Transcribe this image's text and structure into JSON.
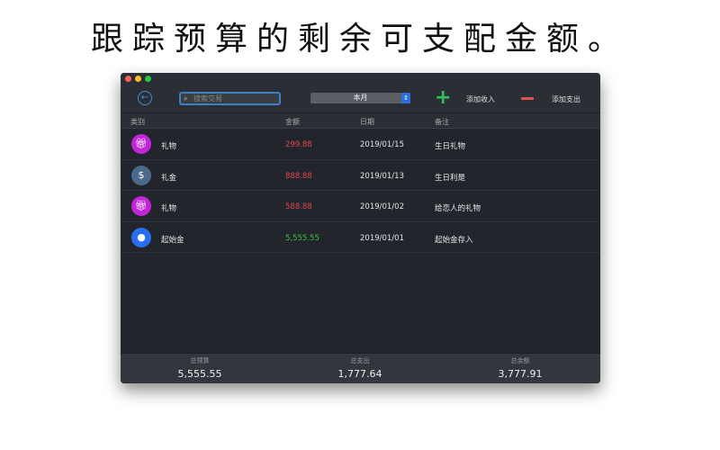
{
  "headline": "跟踪预算的剩余可支配金额。",
  "toolbar": {
    "search_placeholder": "搜索交易",
    "period": "本月",
    "add_income": "添加收入",
    "add_expense": "添加支出"
  },
  "columns": {
    "category": "类别",
    "amount": "金额",
    "date": "日期",
    "note": "备注"
  },
  "rows": [
    {
      "category": "礼物",
      "amount": "299.88",
      "date": "2019/01/15",
      "note": "生日礼物",
      "icon": "gift-icon",
      "icon_color": "#c126d6",
      "amount_color": "#e0474c"
    },
    {
      "category": "礼金",
      "amount": "888.88",
      "date": "2019/01/13",
      "note": "生日利是",
      "icon": "money-bag-icon",
      "icon_color": "#4a6a8c",
      "amount_color": "#e0474c"
    },
    {
      "category": "礼物",
      "amount": "588.88",
      "date": "2019/01/02",
      "note": "给恋人的礼物",
      "icon": "gift-icon",
      "icon_color": "#c126d6",
      "amount_color": "#e0474c"
    },
    {
      "category": "起始金",
      "amount": "5,555.55",
      "date": "2019/01/01",
      "note": "起始金存入",
      "icon": "piggy-bank-icon",
      "icon_color": "#2a6ef0",
      "amount_color": "#3fbf3f"
    }
  ],
  "footer": {
    "budget_label": "总预算",
    "budget": "5,555.55",
    "spent_label": "总支出",
    "spent": "1,777.64",
    "remaining_label": "总余额",
    "remaining": "3,777.91"
  }
}
